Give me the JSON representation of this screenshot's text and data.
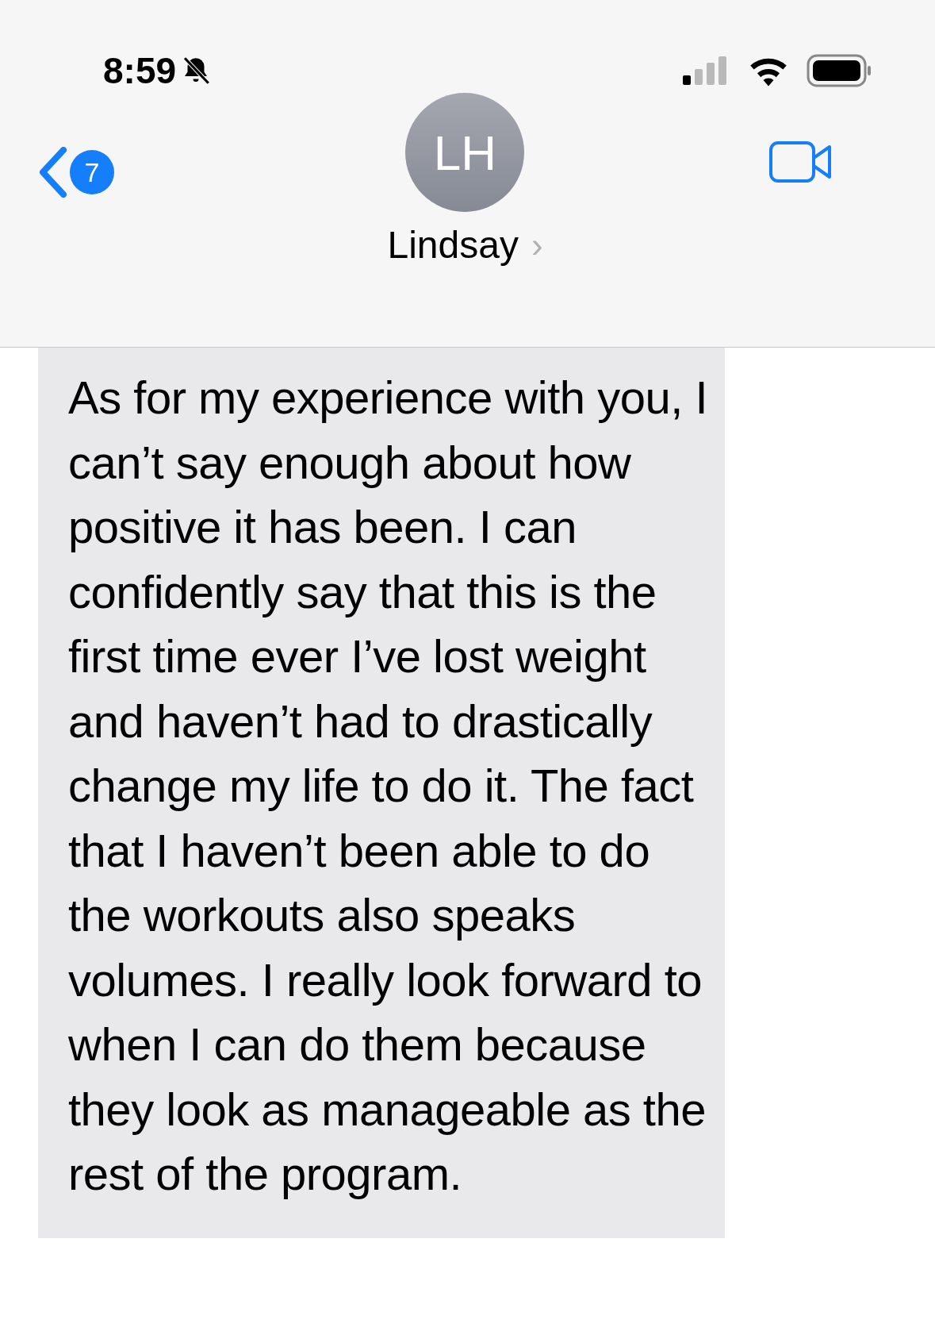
{
  "status_bar": {
    "time": "8:59"
  },
  "header": {
    "back_badge": "7",
    "avatar_initials": "LH",
    "contact_name": "Lindsay",
    "chevron": "›"
  },
  "messages": [
    {
      "text": "As for my experience with you, I can’t say enough about how positive it has been. I can confidently say that this is the first time ever I’ve lost weight and haven’t had to drastically change my life to do it. The fact that I haven’t been able to do the workouts also speaks volumes. I really look forward to when I can do them because they look as manageable as the rest of the program."
    }
  ]
}
